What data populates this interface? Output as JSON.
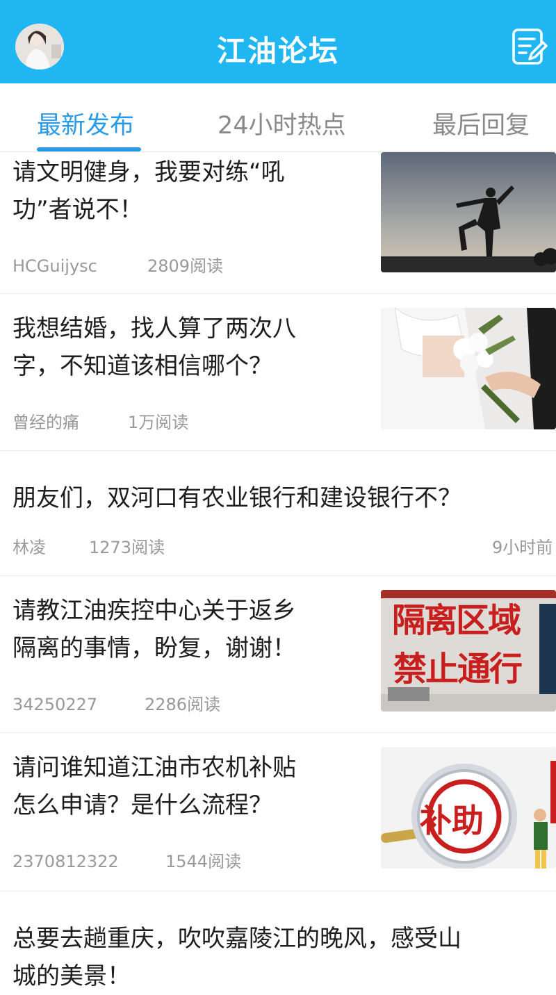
{
  "header": {
    "title": "江油论坛",
    "avatar_icon": "user-avatar",
    "edit_icon": "compose-icon",
    "background": "#1fb6f2"
  },
  "tabs": [
    {
      "label": "最新发布",
      "active": true
    },
    {
      "label": "24小时热点",
      "active": false
    },
    {
      "label": "最后回复",
      "active": false
    }
  ],
  "accent_color": "#2b9ae6",
  "posts": [
    {
      "title_line1": "请文明健身，我要对练“吼",
      "title_line2": "功”者说不！",
      "author": "HCGuijysc",
      "reads": "2809阅读",
      "thumb": "tai-chi-silhouette"
    },
    {
      "title_line1": "我想结婚，找人算了两次八",
      "title_line2": "字，不知道该相信哪个？",
      "author": "曾经的痛",
      "reads": "1万阅读",
      "thumb": "wedding-bouquet"
    },
    {
      "title_line1": "朋友们，双河口有农业银行和建设银行不？",
      "author": "林凌",
      "reads": "1273阅读",
      "time": "9小时前"
    },
    {
      "title_line1": "请教江油疾控中心关于返乡",
      "title_line2": "隔离的事情，盼复，谢谢！",
      "author": "34250227",
      "reads": "2286阅读",
      "thumb": "quarantine-sign",
      "thumb_text_1": "隔离区域",
      "thumb_text_2": "禁止通行"
    },
    {
      "title_line1": "请问谁知道江油市农机补贴",
      "title_line2": "怎么申请？是什么流程？",
      "author": "2370812322",
      "reads": "1544阅读",
      "thumb": "subsidy-magnifier",
      "thumb_text": "补助"
    },
    {
      "title_line1": "总要去趟重庆，吹吹嘉陵江的晚风，感受山",
      "title_line2": "城的美景！"
    }
  ]
}
